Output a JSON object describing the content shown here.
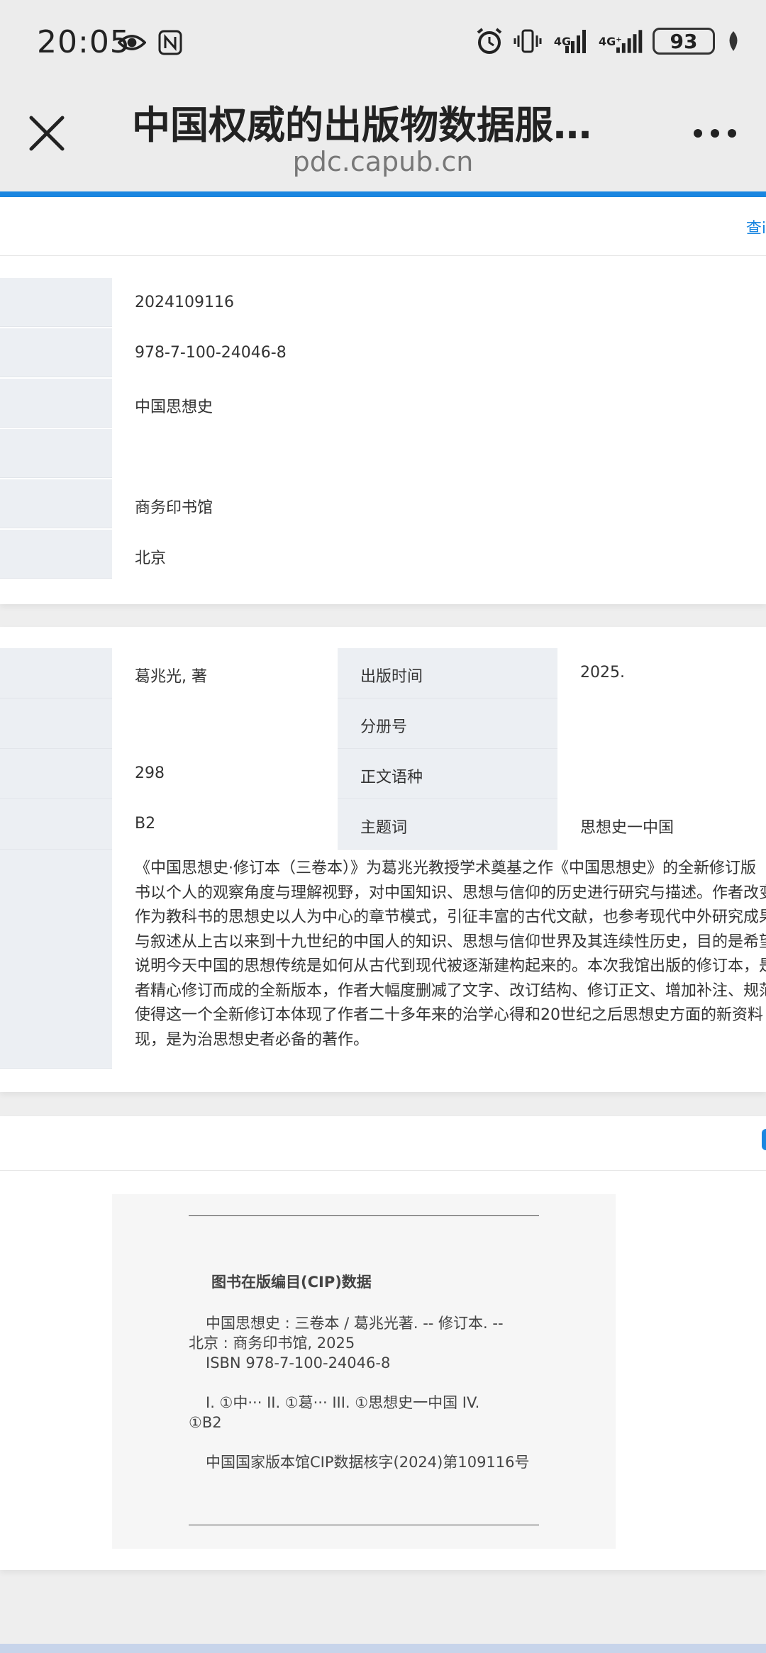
{
  "status_bar": {
    "time": "20:05",
    "battery": "93",
    "left_icons": [
      "eye-icon",
      "nfc-icon"
    ],
    "right_icons": [
      "alarm-icon",
      "vibrate-icon",
      "signal-4g-icon",
      "signal-4g-plus-icon",
      "battery-icon",
      "leaf-icon"
    ],
    "net1": "4G",
    "net2": "4G⁺"
  },
  "browser": {
    "title": "中国权威的出版物数据服…",
    "url": "pdc.capub.cn",
    "top_link": "查i"
  },
  "basic_info": {
    "rows": [
      {
        "value": "2024109116"
      },
      {
        "value": "978-7-100-24046-8"
      },
      {
        "value": "中国思想史"
      },
      {
        "value": ""
      },
      {
        "value": "商务印书馆"
      },
      {
        "value": "北京"
      }
    ]
  },
  "detail_info": {
    "rows": [
      {
        "left_value": "葛兆光, 著",
        "mid_label": "出版时间",
        "right_value": "2025."
      },
      {
        "left_value": "",
        "mid_label": "分册号",
        "right_value": ""
      },
      {
        "left_value": "298",
        "mid_label": "正文语种",
        "right_value": ""
      },
      {
        "left_value": "B2",
        "mid_label": "主题词",
        "right_value": "思想史一中国"
      }
    ],
    "summary_lines": [
      "《中国思想史·修订本（三卷本）》为葛兆光教授学术奠基之作《中国思想史》的全新修订版",
      "书以个人的观察角度与理解视野，对中国知识、思想与信仰的历史进行研究与描述。作者改变",
      "作为教科书的思想史以人为中心的章节模式，引征丰富的古代文献，也参考现代中外研究成果",
      "与叙述从上古以来到十九世纪的中国人的知识、思想与信仰世界及其连续性历史，目的是希望",
      "说明今天中国的思想传统是如何从古代到现代被逐渐建构起来的。本次我馆出版的修订本，是",
      "者精心修订而成的全新版本，作者大幅度删减了文字、改订结构、修订正文、增加补注、规范",
      "使得这一个全新修订本体现了作者二十多年来的治学心得和20世纪之后思想史方面的新资料",
      "现，是为治思想史者必备的著作。"
    ]
  },
  "cip": {
    "title": "图书在版编目(CIP)数据",
    "line1": "中国思想史 : 三卷本 / 葛兆光著. -- 修订本. --",
    "line2": "北京 : 商务印书馆, 2025",
    "line3": "ISBN 978-7-100-24046-8",
    "line4": "I. ①中··· II. ①葛··· III. ①思想史一中国 IV.",
    "line5": "①B2",
    "line6": "中国国家版本馆CIP数据核字(2024)第109116号"
  }
}
